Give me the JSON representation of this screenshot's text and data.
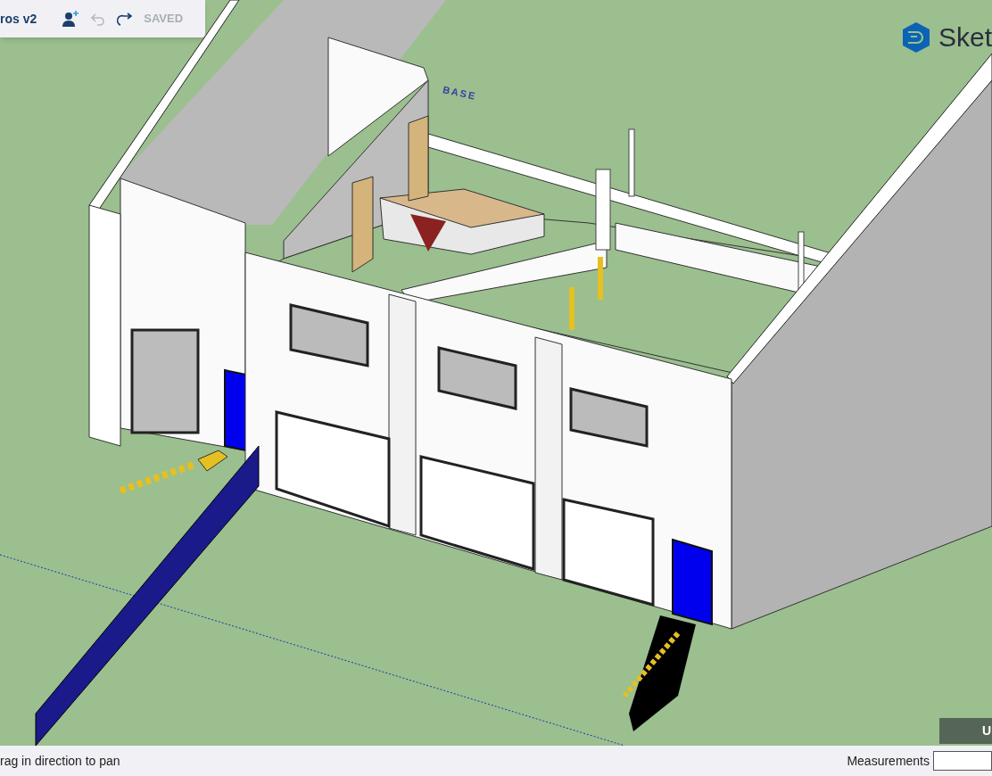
{
  "toolbar": {
    "title": "ros v2",
    "undo": {
      "disabled": true
    },
    "redo": {
      "disabled": false
    },
    "save_status": "SAVED"
  },
  "brand": {
    "name": "Sket"
  },
  "scene": {
    "label": "BASE"
  },
  "viewport_button": {
    "label": "U"
  },
  "status_bar": {
    "hint": "rag in direction to pan",
    "measurements_label": "Measurements"
  }
}
